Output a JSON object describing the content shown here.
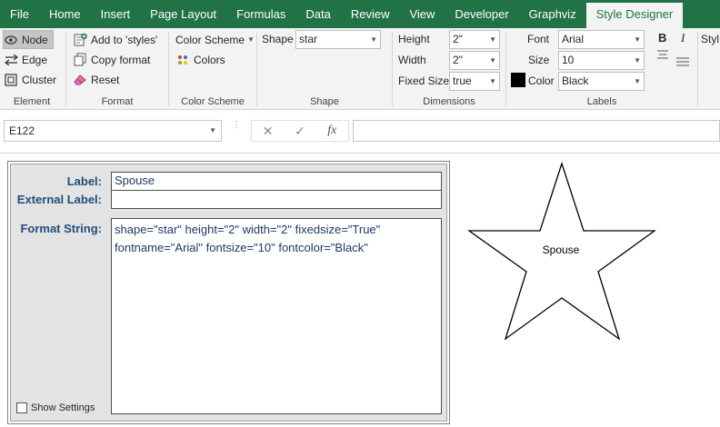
{
  "tabs": [
    "File",
    "Home",
    "Insert",
    "Page Layout",
    "Formulas",
    "Data",
    "Review",
    "View",
    "Developer",
    "Graphviz",
    "Style Designer"
  ],
  "active_tab_index": 10,
  "ribbon": {
    "element": {
      "label": "Element",
      "node": "Node",
      "edge": "Edge",
      "cluster": "Cluster"
    },
    "format": {
      "label": "Format",
      "add_styles": "Add to 'styles'",
      "copy_format": "Copy format",
      "reset": "Reset"
    },
    "color_scheme": {
      "label": "Color Scheme",
      "dropdown": "Color Scheme",
      "colors": "Colors"
    },
    "shape": {
      "label": "Shape",
      "field_label": "Shape",
      "value": "star"
    },
    "dimensions": {
      "label": "Dimensions",
      "height_label": "Height",
      "height_value": "2\"",
      "width_label": "Width",
      "width_value": "2\"",
      "fixed_label": "Fixed Size",
      "fixed_value": "true"
    },
    "labels": {
      "label": "Labels",
      "font_label": "Font",
      "font_value": "Arial",
      "size_label": "Size",
      "size_value": "10",
      "color_label": "Color",
      "color_value": "Black",
      "bold": "B",
      "italic": "I",
      "style_cut": "Styl"
    }
  },
  "formula_bar": {
    "name_box": "E122",
    "fx": "fx",
    "value": ""
  },
  "panel": {
    "label_caption": "Label:",
    "label_value": "Spouse",
    "external_label_caption": "External Label:",
    "external_label_value": "",
    "format_string_caption": "Format String:",
    "format_string_line1": "shape=\"star\" height=\"2\" width=\"2\" fixedsize=\"True\"",
    "format_string_line2": "fontname=\"Arial\" fontsize=\"10\" fontcolor=\"Black\"",
    "show_settings": "Show Settings"
  },
  "preview": {
    "node_label": "Spouse"
  },
  "colors": {
    "excel_green": "#217346",
    "label_blue": "#1f4e79",
    "font_color_swatch": "#000000"
  }
}
